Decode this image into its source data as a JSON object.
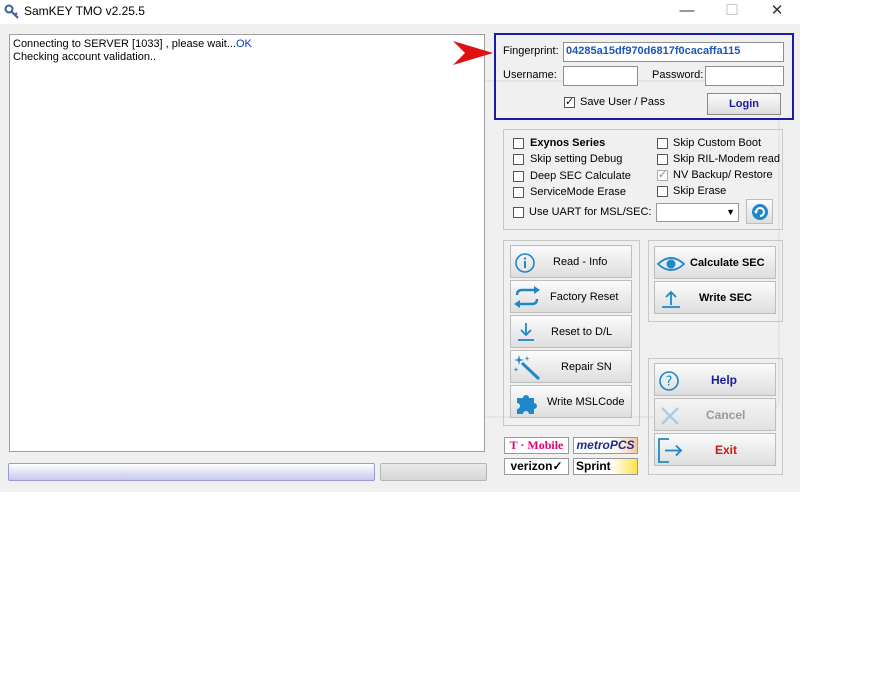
{
  "window": {
    "title": "SamKEY TMO v2.25.5",
    "controls": {
      "minimize": "—",
      "maximize": "☐",
      "close": "✕"
    }
  },
  "log": {
    "line1_text": "Connecting to SERVER [1033] , please wait...",
    "line1_status": "OK",
    "line2": "Checking account validation.."
  },
  "login": {
    "fingerprint_label": "Fingerprint:",
    "fingerprint_value": "04285a15df970d6817f0cacaffa115",
    "username_label": "Username:",
    "username_value": "",
    "password_label": "Password:",
    "password_value": "",
    "save_label": "Save User / Pass",
    "save_checked": true,
    "login_button": "Login"
  },
  "options": {
    "left": [
      {
        "label": "Exynos Series",
        "bold": true,
        "checked": false
      },
      {
        "label": "Skip setting Debug",
        "checked": false
      },
      {
        "label": "Deep SEC Calculate",
        "checked": false
      },
      {
        "label": "ServiceMode Erase",
        "checked": false
      }
    ],
    "right": [
      {
        "label": "Skip Custom Boot",
        "checked": false
      },
      {
        "label": "Skip RIL-Modem read",
        "checked": false
      },
      {
        "label": "NV Backup/ Restore",
        "checked": true,
        "disabled": true
      },
      {
        "label": "Skip Erase",
        "checked": false
      }
    ],
    "uart_label": "Use UART for MSL/SEC:",
    "uart_checked": false,
    "uart_port": ""
  },
  "actions": {
    "read_info": "Read - Info",
    "factory_reset": "Factory Reset",
    "reset_dl": "Reset to D/L",
    "repair_sn": "Repair SN",
    "write_msl": "Write MSLCode",
    "calculate_sec": "Calculate SEC",
    "write_sec": "Write SEC",
    "help": "Help",
    "cancel": "Cancel",
    "exit": "Exit"
  },
  "carriers": {
    "tmobile": "T · Mobile",
    "metro": "metroPCS",
    "verizon": "verizon✓",
    "sprint": "Sprint"
  },
  "colors": {
    "accent_blue": "#1b1ba8",
    "fingerprint": "#1d57b8",
    "icon_blue": "#1e88c8",
    "exit_red": "#c41a1a",
    "tmobile": "#e20074",
    "arrow_red": "#e01010"
  }
}
